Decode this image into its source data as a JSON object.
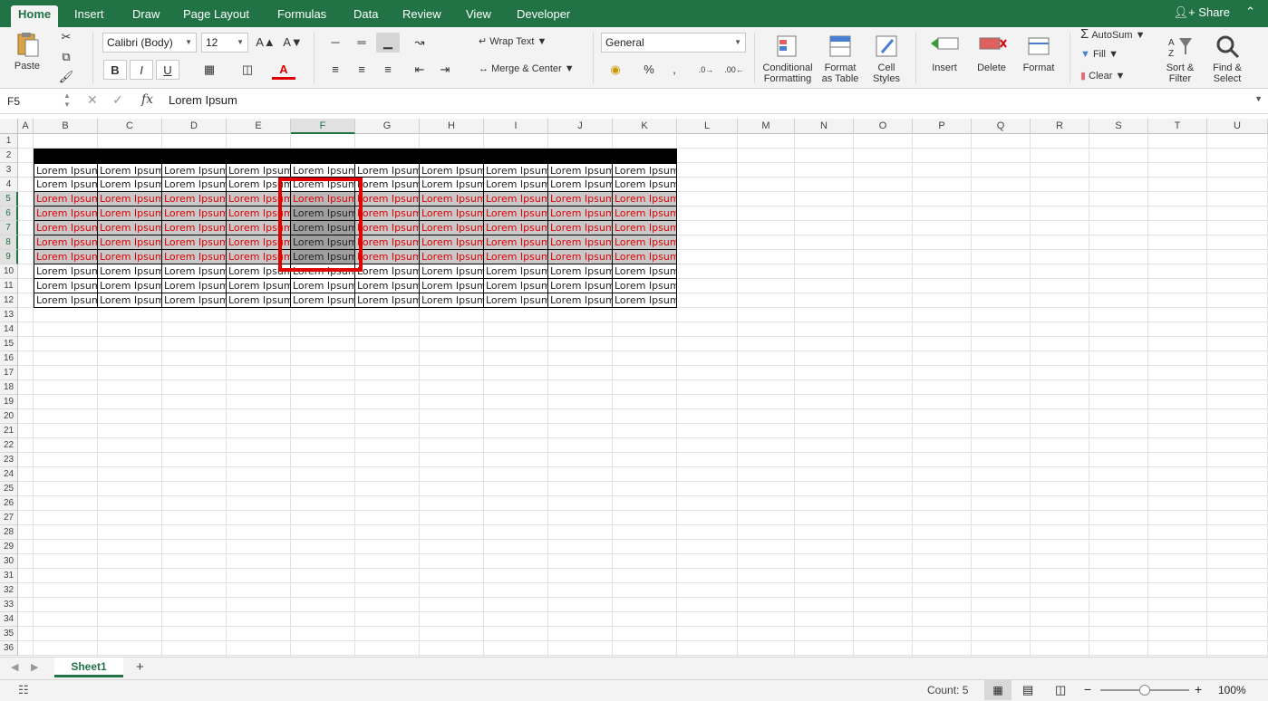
{
  "tabs": [
    "Home",
    "Insert",
    "Draw",
    "Page Layout",
    "Formulas",
    "Data",
    "Review",
    "View",
    "Developer"
  ],
  "share_label": "Share",
  "ribbon": {
    "paste": "Paste",
    "font_name": "Calibri (Body)",
    "font_size": "12",
    "bold": "B",
    "italic": "I",
    "underline": "U",
    "wrap_text": "Wrap Text",
    "merge_center": "Merge & Center",
    "number_format": "General",
    "percent": "%",
    "comma": ",",
    "conditional_formatting": [
      "Conditional",
      "Formatting"
    ],
    "format_as_table": [
      "Format",
      "as Table"
    ],
    "cell_styles": [
      "Cell",
      "Styles"
    ],
    "insert": "Insert",
    "delete": "Delete",
    "format": "Format",
    "autosum": "AutoSum",
    "fill": "Fill",
    "clear": "Clear",
    "sort_filter": [
      "Sort &",
      "Filter"
    ],
    "find_select": [
      "Find &",
      "Select"
    ]
  },
  "formula_bar": {
    "name_box": "F5",
    "fx": "fx",
    "formula": "Lorem Ipsum"
  },
  "columns": [
    "A",
    "B",
    "C",
    "D",
    "E",
    "F",
    "G",
    "H",
    "I",
    "J",
    "K",
    "L",
    "M",
    "N",
    "O",
    "P",
    "Q",
    "R",
    "S",
    "T",
    "U"
  ],
  "rows": [
    "1",
    "2",
    "3",
    "4",
    "5",
    "6",
    "7",
    "8",
    "9",
    "10",
    "11",
    "12",
    "13",
    "14",
    "15",
    "16",
    "17",
    "18",
    "19",
    "20",
    "21",
    "22",
    "23",
    "24",
    "25",
    "26",
    "27",
    "28",
    "29",
    "30",
    "31",
    "32",
    "33",
    "34",
    "35",
    "36"
  ],
  "cell_text": "Lorem Ipsum",
  "selected_rows": [
    "5",
    "6",
    "7",
    "8",
    "9"
  ],
  "sheet_tab": "Sheet1",
  "add_sheet": "+",
  "status": {
    "count": "Count: 5",
    "zoom": "100%",
    "zoom_minus": "−",
    "zoom_plus": "+"
  },
  "colors": {
    "accent": "#217346",
    "highlight": "#e00000",
    "red_text": "#e00000"
  }
}
